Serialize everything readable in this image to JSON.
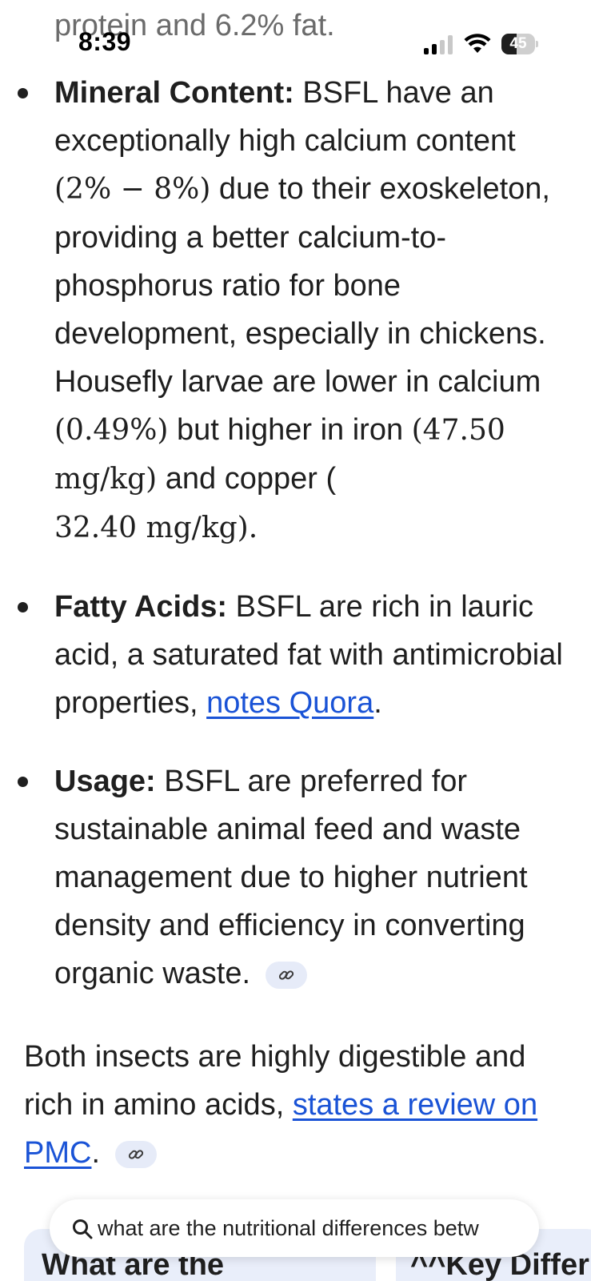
{
  "status_bar": {
    "time": "8:39",
    "battery_level": "45"
  },
  "content": {
    "prev_line": "protein and 6.2% fat.",
    "bullets": [
      {
        "heading": "Mineral Content:",
        "text_1": " BSFL have an exceptionally high calcium content ",
        "math_1": "(2% − 8%)",
        "text_2": " due to their exoskeleton, providing a better calcium-to-phosphorus ratio for bone development, especially in chickens. Housefly larvae are lower in calcium ",
        "math_2": "(0.49%)",
        "text_3": " but higher in iron ",
        "math_3": "(47.50 mg/kg)",
        "text_4": " and copper ( ",
        "math_4": "32.40 mg/kg).",
        "text_5": ""
      },
      {
        "heading": "Fatty Acids:",
        "text_1": " BSFL are rich in lauric acid, a saturated fat with antimicrobial properties, ",
        "link": "notes Quora",
        "text_2": "."
      },
      {
        "heading": "Usage:",
        "text_1": " BSFL are preferred for sustainable animal feed and waste management due to higher nutrient density and efficiency in converting organic waste. "
      }
    ],
    "paragraph": {
      "text_1": "Both insects are highly digestible and rich in amino acids, ",
      "link": "states a review on PMC",
      "text_2": ". "
    }
  },
  "search_bar": {
    "query": "what are the nutritional differences betw"
  },
  "cards": [
    {
      "title": "What are the"
    },
    {
      "title": "^^Key Differ"
    }
  ],
  "colors": {
    "link": "#1a53d6",
    "chip": "#e6ebf8",
    "card": "#e9eefa"
  }
}
